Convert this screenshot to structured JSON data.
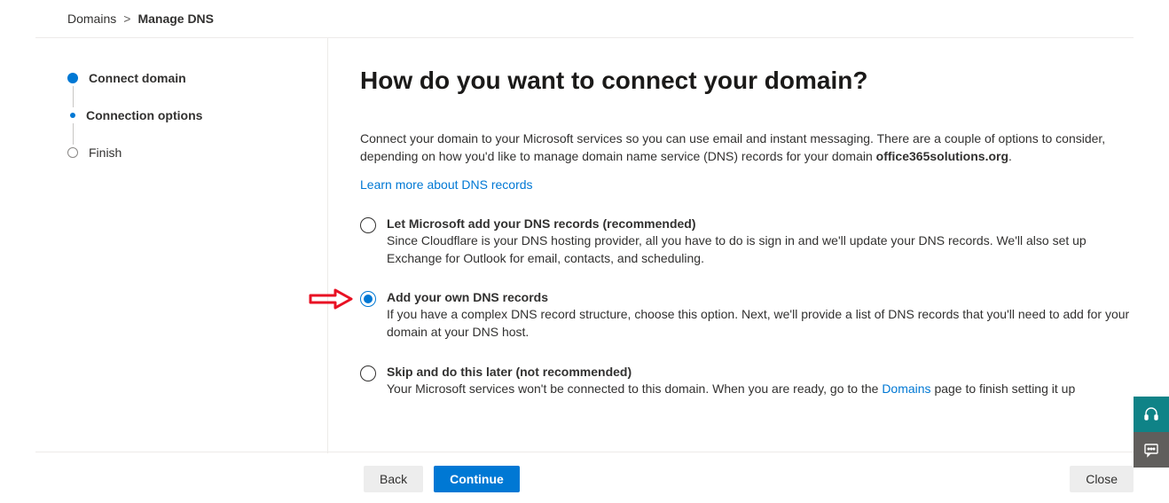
{
  "breadcrumb": {
    "parent": "Domains",
    "current": "Manage DNS"
  },
  "steps": [
    {
      "label": "Connect domain",
      "state": "active"
    },
    {
      "label": "Connection options",
      "state": "sub"
    },
    {
      "label": "Finish",
      "state": "pending"
    }
  ],
  "heading": "How do you want to connect your domain?",
  "intro_prefix": "Connect your domain to your Microsoft services so you can use email and instant messaging. There are a couple of options to consider, depending on how you'd like to manage domain name service (DNS) records for your domain ",
  "intro_domain": "office365solutions.org",
  "intro_suffix": ".",
  "learn_more": "Learn more about DNS records",
  "options": [
    {
      "id": "opt-microsoft",
      "title": "Let Microsoft add your DNS records (recommended)",
      "desc": "Since Cloudflare is your DNS hosting provider, all you have to do is sign in and we'll update your DNS records. We'll also set up Exchange for Outlook for email, contacts, and scheduling.",
      "checked": false,
      "arrow": false
    },
    {
      "id": "opt-own",
      "title": "Add your own DNS records",
      "desc": "If you have a complex DNS record structure, choose this option. Next, we'll provide a list of DNS records that you'll need to add for your domain at your DNS host.",
      "checked": true,
      "arrow": true
    },
    {
      "id": "opt-skip",
      "title": "Skip and do this later (not recommended)",
      "desc_prefix": "Your Microsoft services won't be connected to this domain. When you are ready, go to the ",
      "desc_link": "Domains",
      "desc_suffix": " page to finish setting it up",
      "checked": false,
      "arrow": false
    }
  ],
  "buttons": {
    "back": "Back",
    "continue": "Continue",
    "close": "Close"
  }
}
